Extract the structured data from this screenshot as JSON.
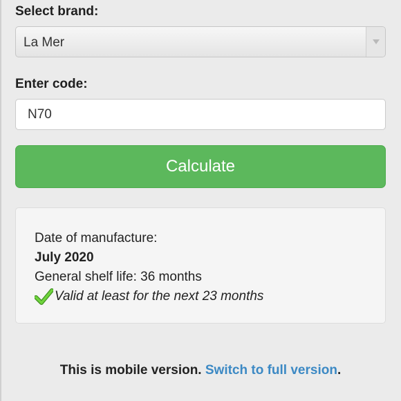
{
  "form": {
    "brand_label": "Select brand:",
    "brand_value": "La Mer",
    "code_label": "Enter code:",
    "code_value": "N70",
    "calculate_label": "Calculate"
  },
  "result": {
    "manufacture_label": "Date of manufacture:",
    "manufacture_date": "July 2020",
    "shelf_life": "General shelf life: 36 months",
    "validity": "Valid at least for the next 23 months"
  },
  "footer": {
    "prefix": "This is mobile version. ",
    "link_text": "Switch to full version",
    "suffix": "."
  },
  "icons": {
    "check": "check-icon",
    "select_arrow": "chevron-down-icon"
  },
  "colors": {
    "button_green": "#5cb85c",
    "link_blue": "#3c89c4",
    "check_green": "#5bbf2f"
  }
}
